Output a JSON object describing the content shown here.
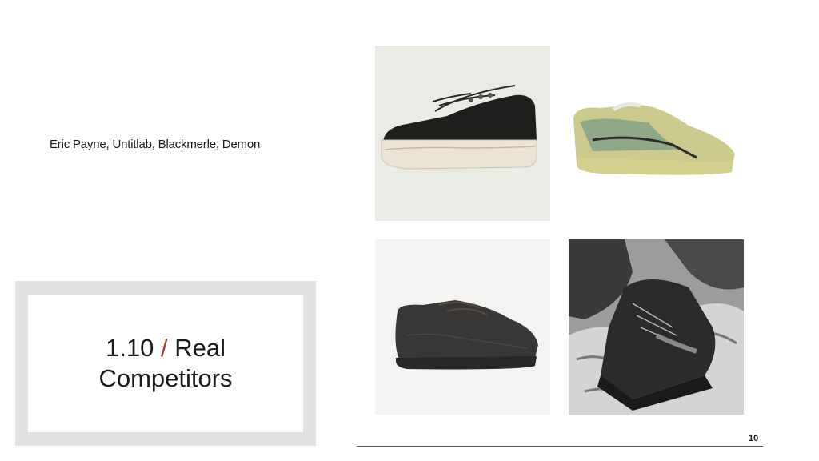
{
  "slide": {
    "brands_caption": "Eric Payne, Untitlab, Blackmerle, Demon",
    "section_number": "1.10",
    "separator": "/",
    "section_title_line1": "Real",
    "section_title_line2": "Competitors",
    "page_number": "10"
  },
  "colors": {
    "accent": "#a83a2c",
    "frame": "#e2e2e2",
    "text": "#1a1a1a"
  },
  "images": [
    {
      "name": "black-suede-platform-sneaker"
    },
    {
      "name": "sage-green-slip-on-sneaker"
    },
    {
      "name": "dark-textured-lace-up-shoe"
    },
    {
      "name": "black-and-white-hiking-boot-on-rock"
    }
  ]
}
